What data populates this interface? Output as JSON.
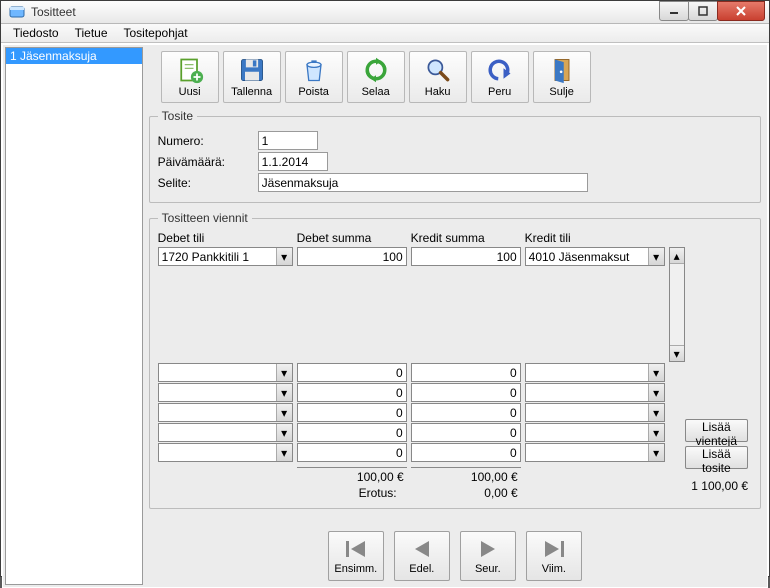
{
  "window": {
    "title": "Tositteet"
  },
  "menu": {
    "file": "Tiedosto",
    "record": "Tietue",
    "templates": "Tositepohjat"
  },
  "sidebar": {
    "items": [
      "1 Jäsenmaksuja"
    ]
  },
  "toolbar": {
    "new": "Uusi",
    "save": "Tallenna",
    "delete": "Poista",
    "browse": "Selaa",
    "search": "Haku",
    "undo": "Peru",
    "close": "Sulje"
  },
  "voucher": {
    "legend": "Tosite",
    "number_label": "Numero:",
    "number": "1",
    "date_label": "Päivämäärä:",
    "date": "1.1.2014",
    "desc_label": "Selite:",
    "desc": "Jäsenmaksuja"
  },
  "entries": {
    "legend": "Tositteen viennit",
    "head": {
      "debit_acc": "Debet tili",
      "debit_sum": "Debet summa",
      "credit_sum": "Kredit summa",
      "credit_acc": "Kredit tili"
    },
    "rows": [
      {
        "debit_acc": "1720 Pankkitili 1",
        "debit": "100",
        "credit": "100",
        "credit_acc": "4010 Jäsenmaksut"
      },
      {
        "debit_acc": "",
        "debit": "0",
        "credit": "0",
        "credit_acc": ""
      },
      {
        "debit_acc": "",
        "debit": "0",
        "credit": "0",
        "credit_acc": ""
      },
      {
        "debit_acc": "",
        "debit": "0",
        "credit": "0",
        "credit_acc": ""
      },
      {
        "debit_acc": "",
        "debit": "0",
        "credit": "0",
        "credit_acc": ""
      },
      {
        "debit_acc": "",
        "debit": "0",
        "credit": "0",
        "credit_acc": ""
      }
    ],
    "debit_total": "100,00 €",
    "credit_total": "100,00 €",
    "diff_label": "Erotus:",
    "diff_value": "0,00 €"
  },
  "buttons": {
    "add_entries": "Lisää vientejä",
    "add_voucher": "Lisää tosite"
  },
  "grand_total": "1 100,00 €",
  "nav": {
    "first": "Ensimm.",
    "prev": "Edel.",
    "next": "Seur.",
    "last": "Viim."
  }
}
